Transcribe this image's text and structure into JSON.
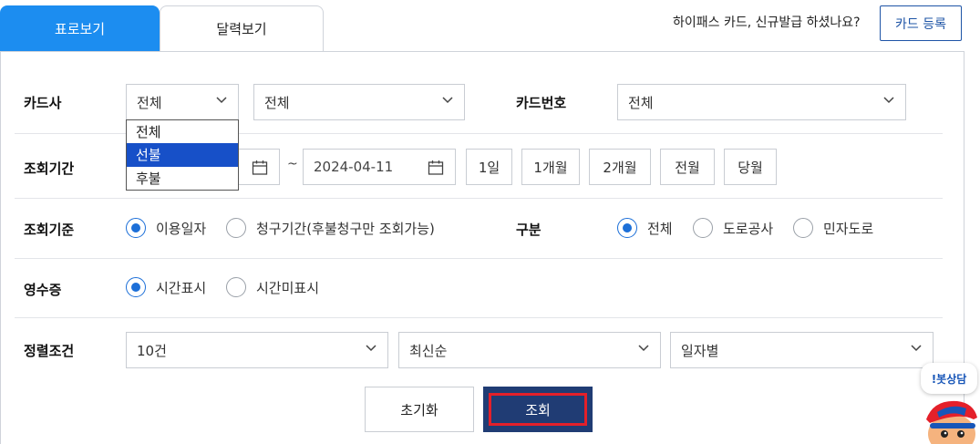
{
  "tabs": {
    "table_view": "표로보기",
    "calendar_view": "달력보기"
  },
  "header": {
    "promo_text": "하이패스 카드, 신규발급 하셨나요?",
    "card_register": "카드 등록"
  },
  "card_company": {
    "label": "카드사",
    "type_select": "전체",
    "company_select": "전체",
    "dropdown_options": [
      "전체",
      "선불",
      "후불"
    ],
    "dropdown_selected_index": 1
  },
  "card_number": {
    "label": "카드번호",
    "select": "전체"
  },
  "period": {
    "label": "조회기간",
    "tilde": "~",
    "end_date": "2024-04-11",
    "buttons": [
      "1일",
      "1개월",
      "2개월",
      "전월",
      "당월"
    ]
  },
  "criteria": {
    "label": "조회기준",
    "options": [
      "이용일자",
      "청구기간(후불청구만 조회가능)"
    ],
    "selected": "이용일자"
  },
  "category": {
    "label": "구분",
    "options": [
      "전체",
      "도로공사",
      "민자도로"
    ],
    "selected": "전체"
  },
  "receipt": {
    "label": "영수증",
    "options": [
      "시간표시",
      "시간미표시"
    ],
    "selected": "시간표시"
  },
  "sort": {
    "label": "정렬조건",
    "count": "10건",
    "order": "최신순",
    "group": "일자별"
  },
  "actions": {
    "reset": "초기화",
    "search": "조회"
  },
  "chatbot": {
    "label": "!봇상담"
  },
  "colors": {
    "accent": "#1c8df0",
    "primary_dark": "#203c74",
    "highlight": "#e4202a",
    "selection": "#1750c8"
  }
}
